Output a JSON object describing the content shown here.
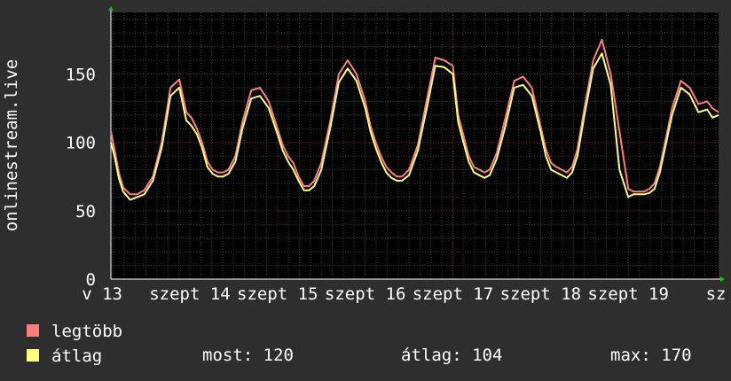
{
  "chart_data": {
    "type": "line",
    "ylabel": "onlinestream.live",
    "ylim": [
      0,
      195
    ],
    "yticks": [
      0,
      50,
      100,
      150
    ],
    "grid": true,
    "x_tick_labels": [
      "v 13",
      "szept 14",
      "szept 15",
      "szept 16",
      "szept 17",
      "szept 18",
      "szept 19",
      "sz"
    ],
    "x_start": 0.1,
    "x_end": 7.03,
    "series": [
      {
        "name": "legtöbb",
        "color": "#ff7f7f",
        "x": [
          0.1,
          0.14,
          0.19,
          0.24,
          0.32,
          0.4,
          0.48,
          0.58,
          0.68,
          0.78,
          0.88,
          0.96,
          1.02,
          1.08,
          1.14,
          1.2,
          1.26,
          1.32,
          1.38,
          1.44,
          1.52,
          1.6,
          1.7,
          1.8,
          1.9,
          2.0,
          2.06,
          2.12,
          2.18,
          2.24,
          2.3,
          2.36,
          2.42,
          2.5,
          2.6,
          2.7,
          2.8,
          2.9,
          3.0,
          3.06,
          3.12,
          3.18,
          3.24,
          3.3,
          3.36,
          3.42,
          3.5,
          3.6,
          3.7,
          3.8,
          3.9,
          4.0,
          4.06,
          4.12,
          4.18,
          4.24,
          4.3,
          4.36,
          4.42,
          4.5,
          4.6,
          4.7,
          4.8,
          4.9,
          5.0,
          5.06,
          5.12,
          5.18,
          5.24,
          5.3,
          5.36,
          5.42,
          5.5,
          5.6,
          5.7,
          5.8,
          5.9,
          6.0,
          6.06,
          6.12,
          6.18,
          6.24,
          6.3,
          6.36,
          6.42,
          6.5,
          6.6,
          6.7,
          6.8,
          6.9,
          6.96,
          7.03
        ],
        "values": [
          108,
          95,
          78,
          67,
          62,
          62,
          65,
          75,
          100,
          140,
          146,
          122,
          118,
          110,
          100,
          86,
          80,
          78,
          78,
          80,
          90,
          115,
          138,
          140,
          130,
          110,
          98,
          90,
          85,
          75,
          68,
          68,
          72,
          85,
          115,
          150,
          160,
          150,
          130,
          112,
          100,
          90,
          82,
          78,
          75,
          75,
          80,
          98,
          130,
          162,
          160,
          156,
          120,
          105,
          90,
          82,
          80,
          78,
          80,
          92,
          118,
          145,
          148,
          140,
          112,
          95,
          85,
          82,
          80,
          78,
          82,
          95,
          125,
          160,
          175,
          150,
          108,
          66,
          64,
          64,
          64,
          66,
          70,
          82,
          100,
          125,
          145,
          140,
          128,
          130,
          125,
          122
        ]
      },
      {
        "name": "átlag",
        "color": "#ffff80",
        "x": [
          0.1,
          0.14,
          0.19,
          0.24,
          0.32,
          0.4,
          0.48,
          0.58,
          0.68,
          0.78,
          0.88,
          0.96,
          1.02,
          1.08,
          1.14,
          1.2,
          1.26,
          1.32,
          1.38,
          1.44,
          1.52,
          1.6,
          1.7,
          1.8,
          1.9,
          2.0,
          2.06,
          2.12,
          2.18,
          2.24,
          2.3,
          2.36,
          2.42,
          2.5,
          2.6,
          2.7,
          2.8,
          2.9,
          3.0,
          3.06,
          3.12,
          3.18,
          3.24,
          3.3,
          3.36,
          3.42,
          3.5,
          3.6,
          3.7,
          3.8,
          3.9,
          4.0,
          4.06,
          4.12,
          4.18,
          4.24,
          4.3,
          4.36,
          4.42,
          4.5,
          4.6,
          4.7,
          4.8,
          4.9,
          5.0,
          5.06,
          5.12,
          5.18,
          5.24,
          5.3,
          5.36,
          5.42,
          5.5,
          5.6,
          5.7,
          5.8,
          5.9,
          6.0,
          6.06,
          6.12,
          6.18,
          6.24,
          6.3,
          6.36,
          6.42,
          6.5,
          6.6,
          6.7,
          6.8,
          6.9,
          6.96,
          7.03
        ],
        "values": [
          100,
          90,
          74,
          64,
          58,
          60,
          62,
          72,
          96,
          134,
          140,
          116,
          112,
          106,
          96,
          82,
          77,
          75,
          75,
          77,
          86,
          110,
          132,
          134,
          125,
          106,
          94,
          86,
          80,
          72,
          65,
          65,
          68,
          80,
          110,
          144,
          154,
          145,
          125,
          108,
          96,
          86,
          78,
          74,
          72,
          72,
          76,
          94,
          124,
          156,
          155,
          150,
          115,
          100,
          86,
          78,
          76,
          74,
          76,
          88,
          112,
          140,
          142,
          134,
          108,
          90,
          80,
          78,
          76,
          74,
          78,
          90,
          120,
          154,
          165,
          142,
          80,
          60,
          62,
          62,
          62,
          63,
          66,
          78,
          96,
          120,
          140,
          135,
          122,
          124,
          118,
          120
        ]
      }
    ]
  },
  "legend": {
    "items": [
      {
        "label": "legtöbb",
        "color": "#ff7f7f"
      },
      {
        "label": "átlag",
        "color": "#ffff80"
      }
    ]
  },
  "stats": {
    "now": "most: 120",
    "avg": "átlag: 104",
    "max": "max: 170"
  }
}
